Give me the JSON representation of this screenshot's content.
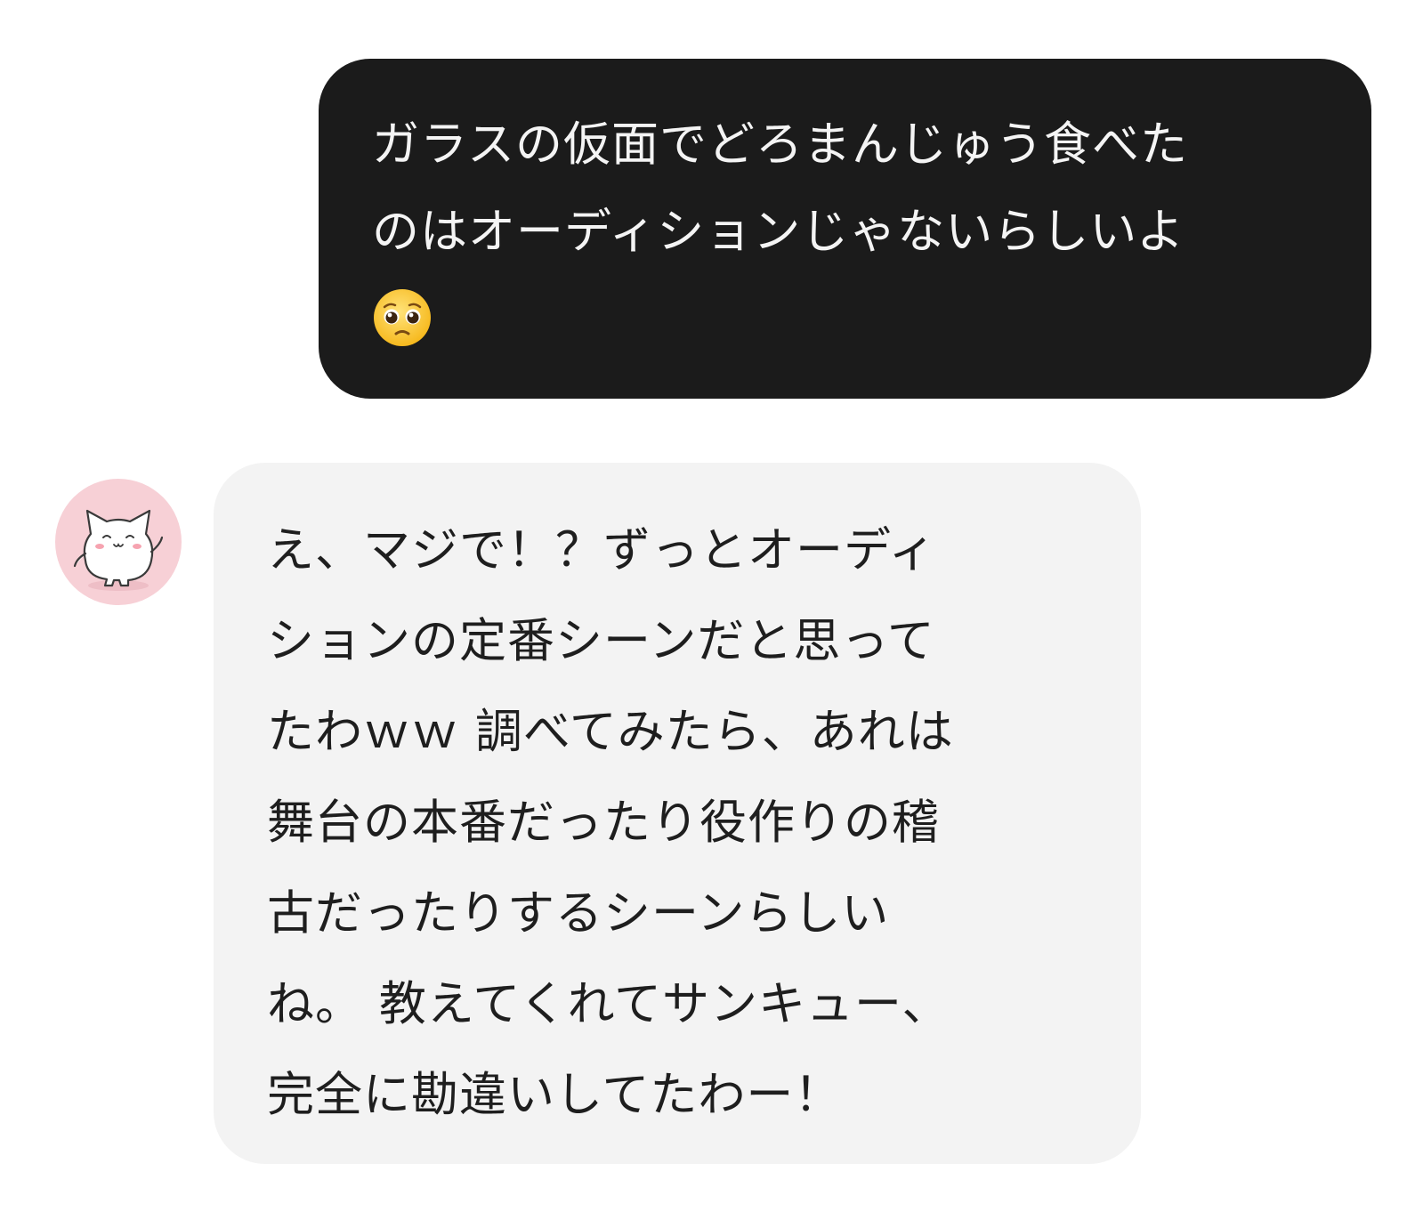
{
  "messages": [
    {
      "sender": "user",
      "lines": [
        "ガラスの仮面でどろまんじゅう食べた",
        "のはオーディションじゃないらしいよ"
      ],
      "emoji": "pleading-face"
    },
    {
      "sender": "bot",
      "avatar": "white-cat-avatar",
      "lines": [
        "え、マジで！？ずっとオーディ",
        "ションの定番シーンだと思って",
        "たわｗｗ 調べてみたら、あれは",
        "舞台の本番だったり役作りの稽",
        "古だったりするシーンらしい",
        "ね。 教えてくれてサンキュー、",
        "完全に勘違いしてたわー！"
      ]
    }
  ],
  "colors": {
    "user_bubble": "#1b1b1b",
    "user_text": "#f4f4f4",
    "bot_bubble": "#f3f3f3",
    "bot_text": "#1e1e1e",
    "avatar_bg": "#f7d0d6",
    "background": "#ffffff"
  }
}
